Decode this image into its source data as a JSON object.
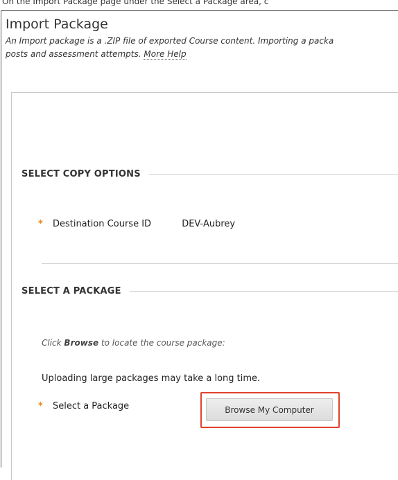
{
  "caption": "On the Import Package page under the Select a Package area, c",
  "header": {
    "title": "Import Package",
    "description": "An Import package is a .ZIP file of exported Course content. Importing a packa",
    "description_line2": "posts and assessment attempts.",
    "more_help": "More Help"
  },
  "copy_options": {
    "heading": "SELECT COPY OPTIONS",
    "destination_label": "Destination Course ID",
    "destination_value": "DEV-Aubrey"
  },
  "package": {
    "heading": "SELECT A PACKAGE",
    "instruction_prefix": "Click",
    "instruction_bold": "Browse",
    "instruction_suffix": "to locate the course package:",
    "warning": "Uploading large packages may take a long time.",
    "select_label": "Select a Package",
    "browse_button": "Browse My Computer"
  },
  "colors": {
    "required_star": "#e88a1a",
    "highlight_border": "#e0432a"
  }
}
